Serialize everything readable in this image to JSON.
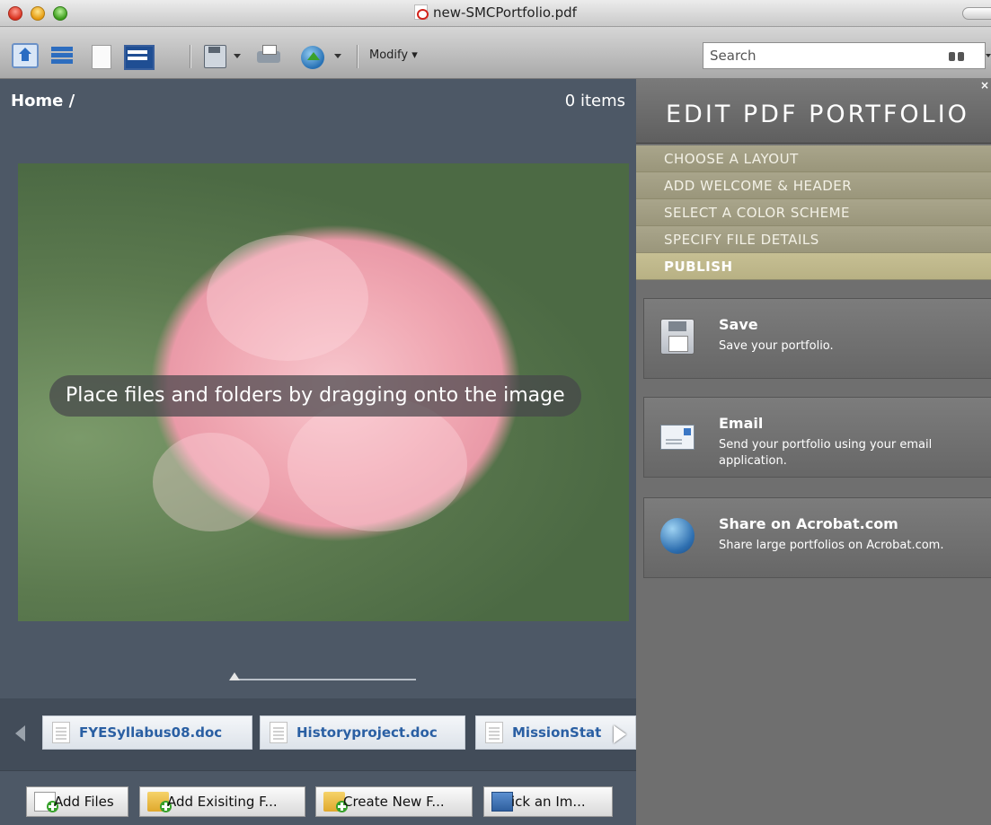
{
  "window": {
    "title": "new-SMCPortfolio.pdf"
  },
  "toolbar": {
    "modify_label": "Modify ▾",
    "search_placeholder": "Search"
  },
  "left": {
    "breadcrumb": "Home /",
    "item_count": "0 items",
    "photo_hint": "Place files and folders by dragging onto the image",
    "files": [
      {
        "label": "FYESyllabus08.doc"
      },
      {
        "label": "Historyproject.doc"
      },
      {
        "label": "MissionStat"
      }
    ],
    "bottom_buttons": [
      {
        "label": "Add Files"
      },
      {
        "label": "Add Exisiting F..."
      },
      {
        "label": "Create New F..."
      },
      {
        "label": "ick an Im..."
      }
    ]
  },
  "right": {
    "title": "EDIT PDF PORTFOLIO",
    "close": "×",
    "steps": [
      {
        "label": "CHOOSE A LAYOUT"
      },
      {
        "label": "ADD WELCOME & HEADER"
      },
      {
        "label": "SELECT A COLOR SCHEME"
      },
      {
        "label": "SPECIFY FILE DETAILS"
      },
      {
        "label": "PUBLISH"
      }
    ],
    "cards": [
      {
        "title": "Save",
        "desc": "Save your portfolio."
      },
      {
        "title": "Email",
        "desc": "Send your portfolio using your email application."
      },
      {
        "title": "Share on Acrobat.com",
        "desc": "Share large portfolios on Acrobat.com."
      }
    ]
  }
}
